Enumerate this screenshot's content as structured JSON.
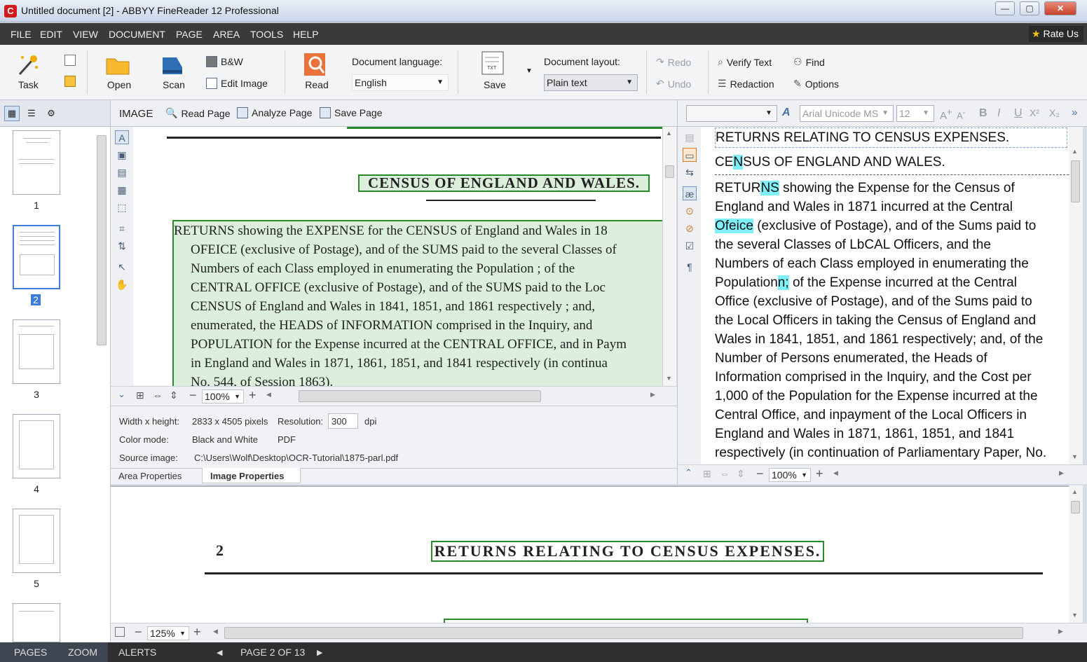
{
  "window": {
    "title": "Untitled document [2] - ABBYY FineReader 12 Professional",
    "app_icon": "C",
    "min": "—",
    "max": "▢",
    "close": "✕"
  },
  "menu": {
    "items": [
      "FILE",
      "EDIT",
      "VIEW",
      "DOCUMENT",
      "PAGE",
      "AREA",
      "TOOLS",
      "HELP"
    ],
    "rate_us": "Rate Us"
  },
  "ribbon": {
    "task": "Task",
    "open": "Open",
    "scan": "Scan",
    "bw": "B&W",
    "edit_image": "Edit Image",
    "read": "Read",
    "doc_language_label": "Document language:",
    "doc_language_value": "English",
    "save": "Save",
    "doc_layout_label": "Document layout:",
    "doc_layout_value": "Plain text",
    "redo": "Redo",
    "undo": "Undo",
    "verify_text": "Verify Text",
    "redaction": "Redaction",
    "find": "Find",
    "options": "Options"
  },
  "image_toolbar": {
    "title": "IMAGE",
    "read_page": "Read Page",
    "analyze_page": "Analyze Page",
    "save_page": "Save Page"
  },
  "text_toolbar": {
    "font": "Arial Unicode MS",
    "size": "12",
    "bold": "B",
    "italic": "I",
    "underline": "U",
    "sup": "X²",
    "sub": "X₂",
    "more": "»"
  },
  "pages": [
    {
      "num": "1"
    },
    {
      "num": "2"
    },
    {
      "num": "3"
    },
    {
      "num": "4"
    },
    {
      "num": "5"
    }
  ],
  "image_view": {
    "heading": "CENSUS OF ENGLAND AND WALES.",
    "body_lines": [
      "RETURNS showing the EXPENSE for the CENSUS of England and Wales in 18",
      "OFEICE (exclusive of Postage), and of the SUMS paid to the several Classes of",
      "Numbers of each Class employed in enumerating the Population ; of the",
      "CENTRAL OFFICE (exclusive of Postage), and of the SUMS paid to the Loc",
      "CENSUS of England and Wales in 1841, 1851, and 1861 respectively ; and,",
      "enumerated, the HEADS of INFORMATION comprised in the Inquiry, and",
      "POPULATION for the Expense incurred at the CENTRAL OFFICE, and in Paym",
      "in England and Wales in 1871, 1861, 1851, and 1841 respectively (in continua",
      "No. 544, of Session 1863)."
    ],
    "zoom": "100%"
  },
  "properties": {
    "wh_label": "Width x height:",
    "wh_value": "2833 x 4505 pixels",
    "res_label": "Resolution:",
    "res_value": "300",
    "res_unit": "dpi",
    "color_label": "Color mode:",
    "color_value": "Black and White",
    "format": "PDF",
    "source_label": "Source image:",
    "source_value": "C:\\Users\\Wolf\\Desktop\\OCR-Tutorial\\1875-parl.pdf",
    "tab_area": "Area Properties",
    "tab_image": "Image Properties"
  },
  "text_view": {
    "line1": "RETURNS RELATING TO CENSUS EXPENSES.",
    "line2_a": "CE",
    "line2_b": "N",
    "line2_c": "SUS OF ENGLAND AND WALES.",
    "para_lines": [
      "showing the Expense for the Census of",
      "England and Wales in 1871 incurred at the Central",
      "(exclusive of Postage), and of the Sums paid to",
      "several Classes of LbCAL Officers, and the",
      "Numbers of each Class employed in enumerating the",
      "of the Expense incurred at the Central",
      "Office (exclusive of Postage), and of the Sums paid to",
      "the Local Officers in taking the Census of England and",
      "Wales in 1841, 1851, and 1861 respectively; and, of the",
      "Number of Persons enumerated, the Heads of",
      "Information comprised in the Inquiry, and the Cost per",
      "1,000 of the Population for the Expense incurred at the",
      "Central Office, and inpayment of the Local Officers in",
      "England and Wales in 1871, 1861, 1851, and 1841",
      "respectively (in continuation of Parliamentary Paper, No."
    ],
    "returns": "RETUR",
    "ns": "NS",
    "ofeice": "Ofeice",
    "the": "the",
    "population": "Population",
    "semicolon": "n;",
    "zoom": "100%"
  },
  "zoom_view": {
    "page_num": "2",
    "heading": "RETURNS RELATING TO CENSUS EXPENSES.",
    "zoom": "125%"
  },
  "status": {
    "pages": "PAGES",
    "zoom": "ZOOM",
    "alerts": "ALERTS",
    "page_indicator": "PAGE 2 OF 13"
  }
}
